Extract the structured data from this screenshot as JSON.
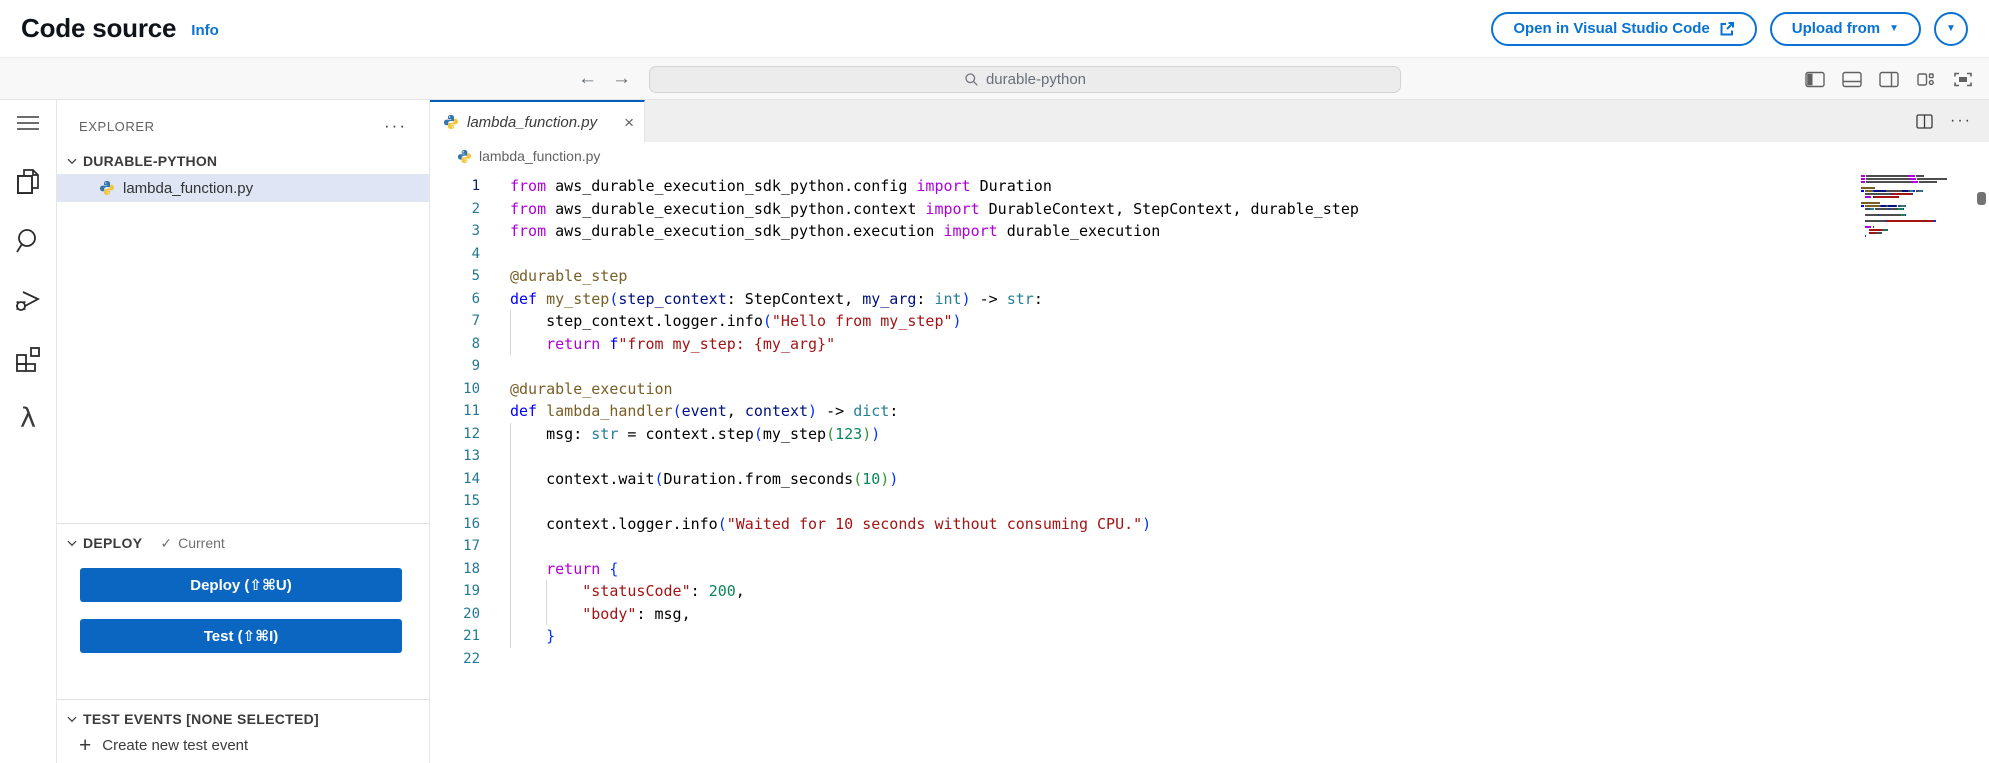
{
  "theme": {
    "accent": "#0972d3",
    "button_blue": "#0b66c2",
    "tab_accent": "#005fb8",
    "selection": "#dfe5f4"
  },
  "icons": {
    "ellipsis": "···",
    "close": "×",
    "check": "✓",
    "plus": "+",
    "caret": "▼",
    "back": "←",
    "forward": "→"
  },
  "header": {
    "title": "Code source",
    "info": "Info",
    "open_vscode": "Open in Visual Studio Code",
    "upload_from": "Upload from"
  },
  "command_bar": {
    "search_value": "durable-python"
  },
  "activity_bar": {
    "items": [
      "menu",
      "explorer",
      "search",
      "run-and-debug",
      "extensions",
      "aws-lambda"
    ]
  },
  "sidebar": {
    "explorer_title": "EXPLORER",
    "folder": {
      "name": "DURABLE-PYTHON",
      "files": [
        {
          "name": "lambda_function.py",
          "selected": true
        }
      ]
    },
    "deploy": {
      "title": "DEPLOY",
      "status": "Current",
      "deploy_button": "Deploy (⇧⌘U)",
      "test_button": "Test (⇧⌘I)"
    },
    "test_events": {
      "title": "TEST EVENTS [NONE SELECTED]",
      "create_label": "Create new test event"
    }
  },
  "editor": {
    "tab_label": "lambda_function.py",
    "breadcrumb": "lambda_function.py",
    "active_line": 1,
    "colors": {
      "kw": "#AF00DB",
      "df": "#0000FF",
      "fn": "#795E26",
      "pr": "#001080",
      "ty": "#267F99",
      "st": "#A31515",
      "nu": "#098658",
      "pl": "#000000",
      "b1": "#0431FA",
      "b2": "#319331"
    },
    "guides": [
      {
        "from": 7,
        "to": 8,
        "col": 0
      },
      {
        "from": 12,
        "to": 21,
        "col": 0
      },
      {
        "from": 19,
        "to": 20,
        "col": 4
      }
    ],
    "lines": [
      {
        "n": 1,
        "tokens": [
          [
            "from",
            "kw"
          ],
          [
            " aws_durable_execution_sdk_python.config ",
            "pl"
          ],
          [
            "import",
            "kw"
          ],
          [
            " Duration",
            "pl"
          ]
        ]
      },
      {
        "n": 2,
        "tokens": [
          [
            "from",
            "kw"
          ],
          [
            " aws_durable_execution_sdk_python.context ",
            "pl"
          ],
          [
            "import",
            "kw"
          ],
          [
            " DurableContext, StepContext, durable_step",
            "pl"
          ]
        ]
      },
      {
        "n": 3,
        "tokens": [
          [
            "from",
            "kw"
          ],
          [
            " aws_durable_execution_sdk_python.execution ",
            "pl"
          ],
          [
            "import",
            "kw"
          ],
          [
            " durable_execution",
            "pl"
          ]
        ]
      },
      {
        "n": 4,
        "tokens": []
      },
      {
        "n": 5,
        "tokens": [
          [
            "@durable_step",
            "fn"
          ]
        ]
      },
      {
        "n": 6,
        "tokens": [
          [
            "def",
            "df"
          ],
          [
            " ",
            "pl"
          ],
          [
            "my_step",
            "fn"
          ],
          [
            "(",
            "b1"
          ],
          [
            "step_context",
            "pr"
          ],
          [
            ": StepContext, ",
            "pl"
          ],
          [
            "my_arg",
            "pr"
          ],
          [
            ": ",
            "pl"
          ],
          [
            "int",
            "ty"
          ],
          [
            ")",
            "b1"
          ],
          [
            " -> ",
            "pl"
          ],
          [
            "str",
            "ty"
          ],
          [
            ":",
            "pl"
          ]
        ]
      },
      {
        "n": 7,
        "tokens": [
          [
            "    step_context.logger.info",
            "pl"
          ],
          [
            "(",
            "b1"
          ],
          [
            "\"Hello from my_step\"",
            "st"
          ],
          [
            ")",
            "b1"
          ]
        ]
      },
      {
        "n": 8,
        "tokens": [
          [
            "    ",
            "pl"
          ],
          [
            "return",
            "kw"
          ],
          [
            " ",
            "pl"
          ],
          [
            "f",
            "df"
          ],
          [
            "\"from my_step: {my_arg}\"",
            "st"
          ]
        ]
      },
      {
        "n": 9,
        "tokens": []
      },
      {
        "n": 10,
        "tokens": [
          [
            "@durable_execution",
            "fn"
          ]
        ]
      },
      {
        "n": 11,
        "tokens": [
          [
            "def",
            "df"
          ],
          [
            " ",
            "pl"
          ],
          [
            "lambda_handler",
            "fn"
          ],
          [
            "(",
            "b1"
          ],
          [
            "event",
            "pr"
          ],
          [
            ", ",
            "pl"
          ],
          [
            "context",
            "pr"
          ],
          [
            ")",
            "b1"
          ],
          [
            " -> ",
            "pl"
          ],
          [
            "dict",
            "ty"
          ],
          [
            ":",
            "pl"
          ]
        ]
      },
      {
        "n": 12,
        "tokens": [
          [
            "    msg: ",
            "pl"
          ],
          [
            "str",
            "ty"
          ],
          [
            " = context.step",
            "pl"
          ],
          [
            "(",
            "b1"
          ],
          [
            "my_step",
            "pl"
          ],
          [
            "(",
            "b2"
          ],
          [
            "123",
            "nu"
          ],
          [
            ")",
            "b2"
          ],
          [
            ")",
            "b1"
          ]
        ]
      },
      {
        "n": 13,
        "tokens": []
      },
      {
        "n": 14,
        "tokens": [
          [
            "    context.wait",
            "pl"
          ],
          [
            "(",
            "b1"
          ],
          [
            "Duration.from_seconds",
            "pl"
          ],
          [
            "(",
            "b2"
          ],
          [
            "10",
            "nu"
          ],
          [
            ")",
            "b2"
          ],
          [
            ")",
            "b1"
          ]
        ]
      },
      {
        "n": 15,
        "tokens": []
      },
      {
        "n": 16,
        "tokens": [
          [
            "    context.logger.info",
            "pl"
          ],
          [
            "(",
            "b1"
          ],
          [
            "\"Waited for 10 seconds without consuming CPU.\"",
            "st"
          ],
          [
            ")",
            "b1"
          ]
        ]
      },
      {
        "n": 17,
        "tokens": []
      },
      {
        "n": 18,
        "tokens": [
          [
            "    ",
            "pl"
          ],
          [
            "return",
            "kw"
          ],
          [
            " ",
            "pl"
          ],
          [
            "{",
            "b1"
          ]
        ]
      },
      {
        "n": 19,
        "tokens": [
          [
            "        ",
            "pl"
          ],
          [
            "\"statusCode\"",
            "st"
          ],
          [
            ": ",
            "pl"
          ],
          [
            "200",
            "nu"
          ],
          [
            ",",
            "pl"
          ]
        ]
      },
      {
        "n": 20,
        "tokens": [
          [
            "        ",
            "pl"
          ],
          [
            "\"body\"",
            "st"
          ],
          [
            ": msg,",
            "pl"
          ]
        ]
      },
      {
        "n": 21,
        "tokens": [
          [
            "    ",
            "pl"
          ],
          [
            "}",
            "b1"
          ]
        ]
      },
      {
        "n": 22,
        "tokens": []
      }
    ]
  }
}
